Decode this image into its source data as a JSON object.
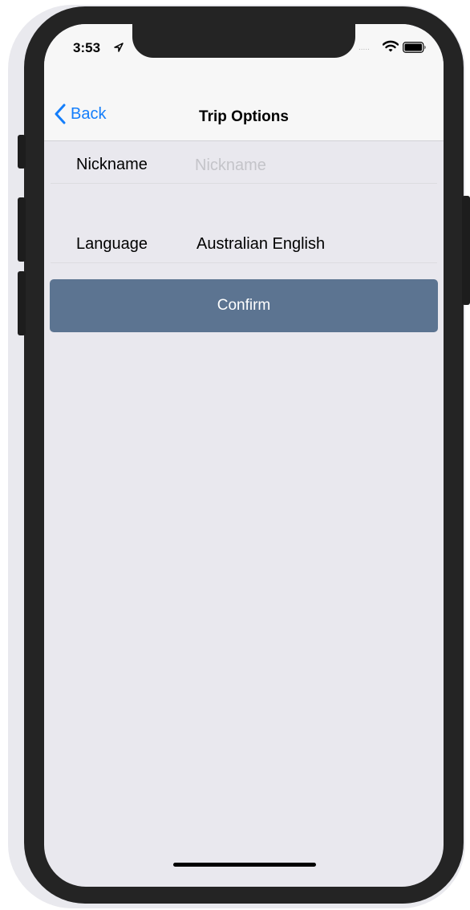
{
  "status_bar": {
    "time": "3:53",
    "signal": "....."
  },
  "nav": {
    "back_label": "Back",
    "title": "Trip Options"
  },
  "form": {
    "nickname": {
      "label": "Nickname",
      "placeholder": "Nickname",
      "value": ""
    },
    "language": {
      "label": "Language",
      "value": "Australian English"
    },
    "confirm_label": "Confirm"
  },
  "colors": {
    "accent": "#147efb",
    "confirm_bg": "#5c7491",
    "background": "#e9e8ee"
  },
  "icons": [
    "location-arrow-icon",
    "wifi-icon",
    "battery-icon",
    "chevron-left-icon"
  ]
}
